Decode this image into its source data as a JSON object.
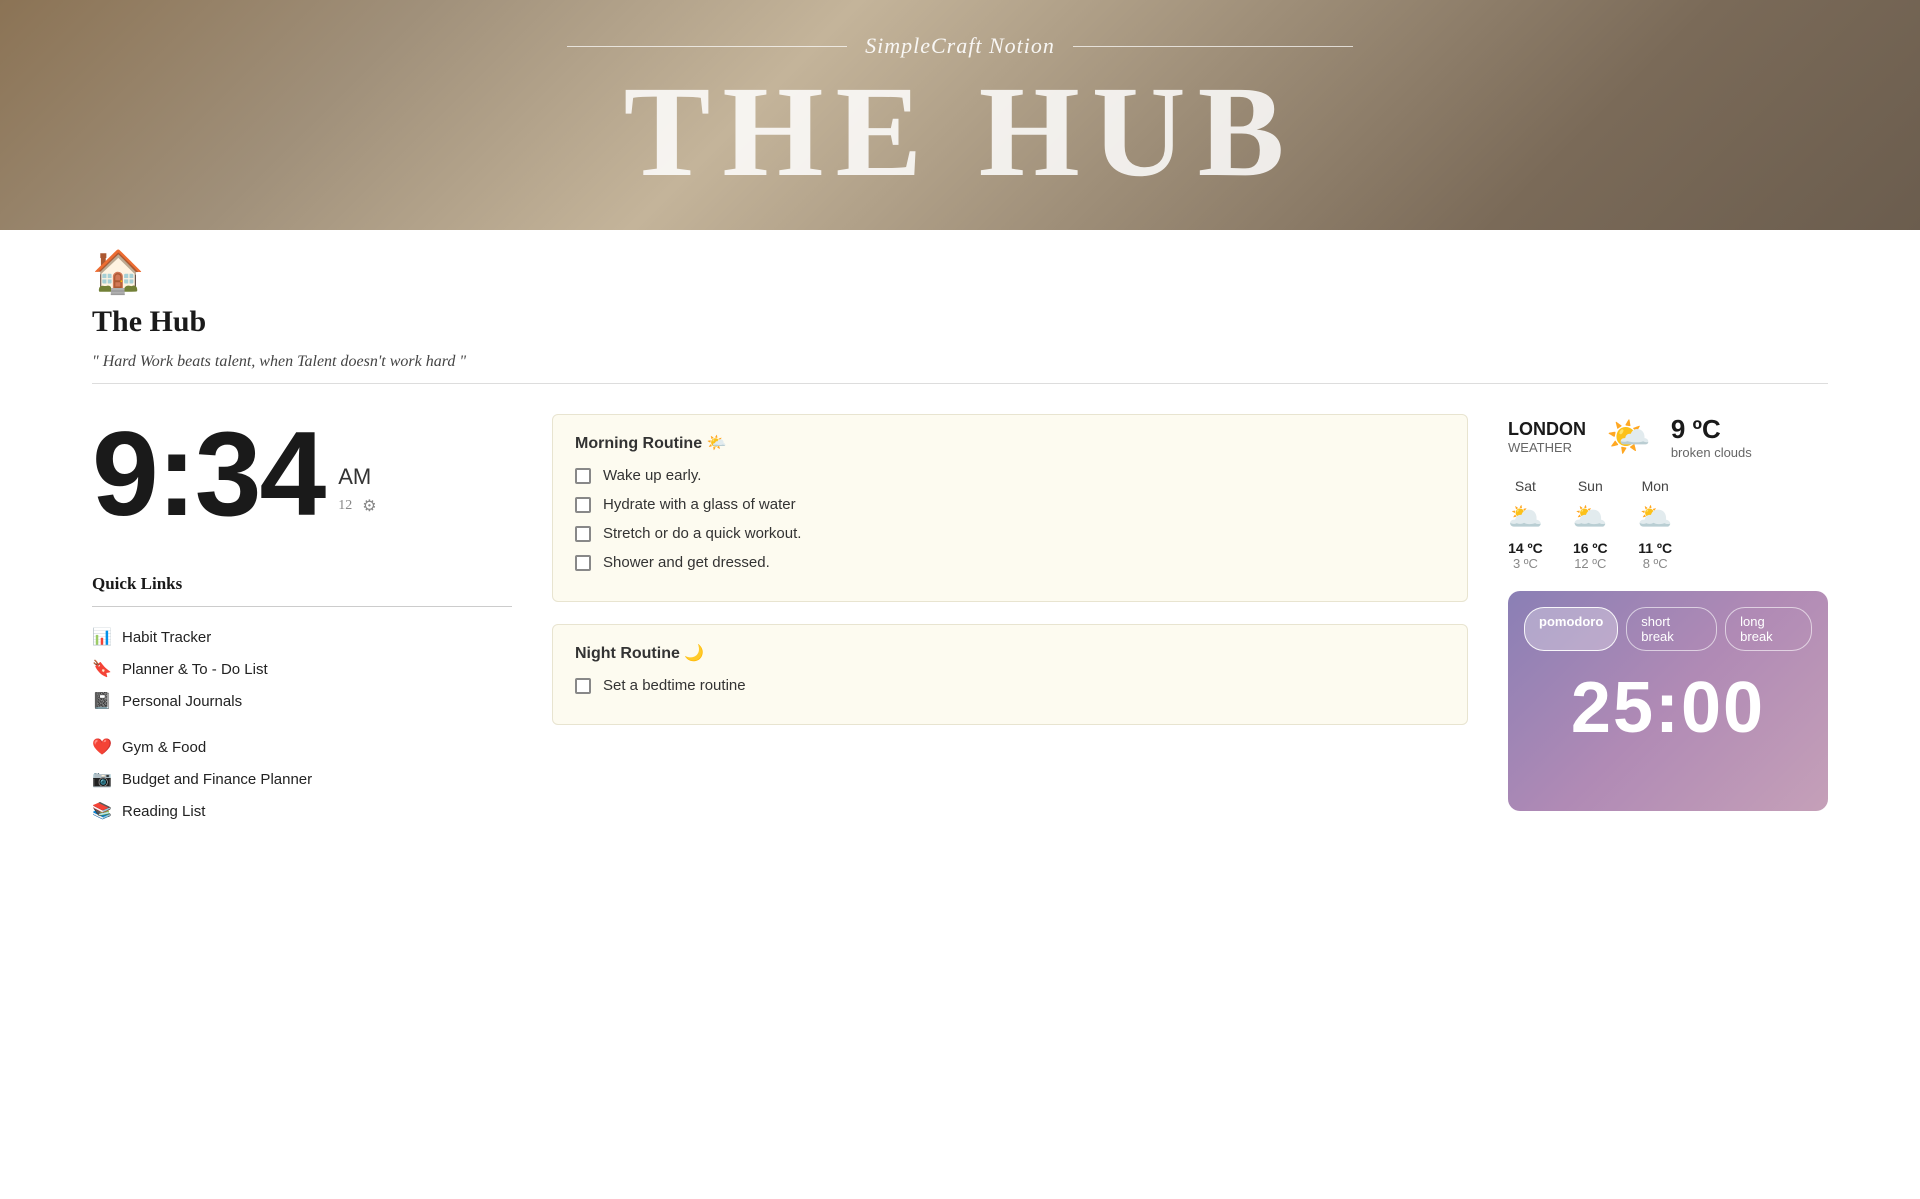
{
  "header": {
    "brand_name": "SimpleCraft Notion",
    "title": "THE HUB"
  },
  "page": {
    "title": "The Hub",
    "quote": "\" Hard Work beats talent, when Talent doesn't work hard \""
  },
  "clock": {
    "time": "9:34",
    "ampm": "AM",
    "format": "12",
    "gear_icon": "⚙"
  },
  "quick_links": {
    "title": "Quick Links",
    "items": [
      {
        "label": "Habit Tracker",
        "icon": "📊"
      },
      {
        "label": "Planner & To - Do List",
        "icon": "🔖"
      },
      {
        "label": "Personal Journals",
        "icon": "📓"
      },
      {
        "label": "Gym & Food",
        "icon": "❤️"
      },
      {
        "label": "Budget and Finance Planner",
        "icon": "📷"
      },
      {
        "label": "Reading List",
        "icon": "📚"
      }
    ]
  },
  "morning_routine": {
    "title": "Morning Routine 🌤️",
    "items": [
      "Wake up early.",
      "Hydrate with a glass of water",
      "Stretch or do a quick workout.",
      "Shower and get dressed."
    ]
  },
  "night_routine": {
    "title": "Night Routine 🌙",
    "items": [
      "Set a bedtime routine"
    ]
  },
  "weather": {
    "city": "LONDON",
    "label": "WEATHER",
    "icon": "🌤️",
    "temp": "9 ºC",
    "desc": "broken clouds",
    "forecast": [
      {
        "day": "Sat",
        "icon": "🌥️",
        "high": "14 ºC",
        "low": "3 ºC"
      },
      {
        "day": "Sun",
        "icon": "🌥️",
        "high": "16 ºC",
        "low": "12 ºC"
      },
      {
        "day": "Mon",
        "icon": "🌥️",
        "high": "11 ºC",
        "low": "8 ºC"
      }
    ]
  },
  "pomodoro": {
    "tabs": [
      "pomodoro",
      "short break",
      "long break"
    ],
    "active_tab": "pomodoro",
    "time": "25:00"
  }
}
